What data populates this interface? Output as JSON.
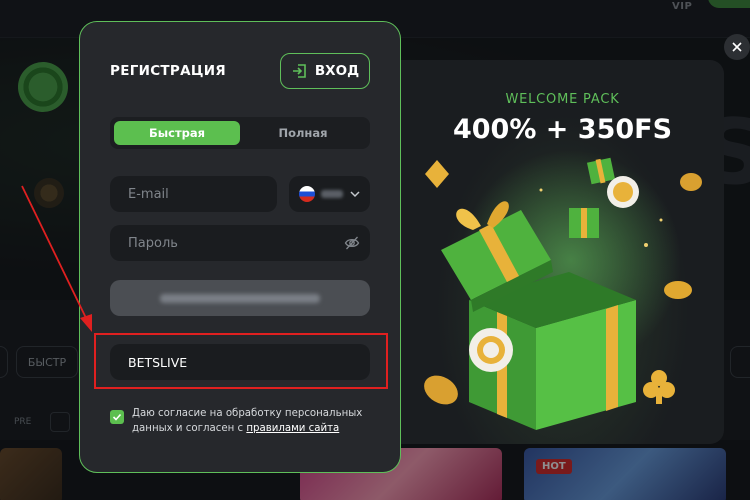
{
  "background": {
    "vip_label": "VIP",
    "pill_label": "БЫСТР",
    "pre_label": "PRE",
    "hot_badge": "HOT"
  },
  "modal": {
    "title": "РЕГИСТРАЦИЯ",
    "login_button": "ВХОД",
    "tabs": [
      {
        "label": "Быстрая",
        "active": true
      },
      {
        "label": "Полная",
        "active": false
      }
    ],
    "email": {
      "placeholder": "E-mail",
      "value": ""
    },
    "country": {
      "flag": "russia-flag",
      "code_blurred": true
    },
    "password": {
      "placeholder": "Пароль",
      "value": ""
    },
    "submit": {
      "label_blurred": true
    },
    "promo_code": {
      "value": "BETSLIVE",
      "highlighted": true
    },
    "consent": {
      "checked": true,
      "text": "Даю согласие на обработку персональных данных и согласен с ",
      "link": "правилами сайта"
    }
  },
  "promo": {
    "subtitle": "WELCOME PACK",
    "title": "400% + 350FS"
  },
  "colors": {
    "accent": "#5cbf4f",
    "highlight": "#e02020",
    "panel": "#26282c",
    "field": "#1a1c1f"
  },
  "icons": [
    "login-icon",
    "russia-flag-icon",
    "chevron-down-icon",
    "eye-off-icon",
    "checkmark-icon",
    "close-icon",
    "gift-box-icon",
    "casino-chip-icon"
  ]
}
